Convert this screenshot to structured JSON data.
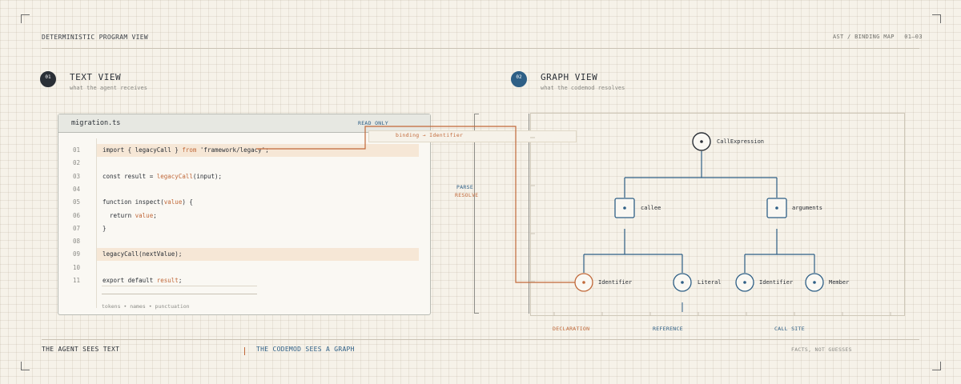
{
  "header": {
    "left_title": "DETERMINISTIC PROGRAM VIEW",
    "right_meta": "AST / BINDING MAP",
    "right_range": "01—03"
  },
  "text_section": {
    "badge": "01",
    "title": "TEXT VIEW",
    "subtitle": "what the agent receives"
  },
  "graph_section": {
    "badge": "02",
    "title": "GRAPH VIEW",
    "subtitle": "what the codemod resolves"
  },
  "editor": {
    "filename": "migration.ts",
    "mode": "READ ONLY",
    "footer": "tokens • names • punctuation",
    "lines": [
      {
        "n": "01",
        "parts": [
          [
            "import { ",
            "n"
          ],
          [
            "legacyCall",
            "n"
          ],
          [
            " } ",
            "n"
          ],
          [
            "from",
            "o"
          ],
          [
            " 'framework/legacy';",
            "n"
          ]
        ],
        "highlight": true
      },
      {
        "n": "02",
        "parts": [],
        "highlight": false
      },
      {
        "n": "03",
        "parts": [
          [
            "const result = ",
            "n"
          ],
          [
            "legacyCall",
            "o"
          ],
          [
            "(input);",
            "n"
          ]
        ],
        "highlight": false
      },
      {
        "n": "04",
        "parts": [],
        "highlight": false
      },
      {
        "n": "05",
        "parts": [
          [
            "function inspect(",
            "n"
          ],
          [
            "value",
            "o"
          ],
          [
            ") {",
            "n"
          ]
        ],
        "highlight": false
      },
      {
        "n": "06",
        "parts": [
          [
            "  return ",
            "n"
          ],
          [
            "value",
            "o"
          ],
          [
            ";",
            "n"
          ]
        ],
        "highlight": false
      },
      {
        "n": "07",
        "parts": [
          [
            "}",
            "n"
          ]
        ],
        "highlight": false
      },
      {
        "n": "08",
        "parts": [],
        "highlight": false
      },
      {
        "n": "09",
        "parts": [
          [
            "legacyCall(nextValue);",
            "n"
          ]
        ],
        "highlight": true
      },
      {
        "n": "10",
        "parts": [],
        "highlight": false
      },
      {
        "n": "11",
        "parts": [
          [
            "export default ",
            "n"
          ],
          [
            "result",
            "o"
          ],
          [
            ";",
            "n"
          ]
        ],
        "highlight": false
      }
    ]
  },
  "connector": {
    "binding_label": "binding → Identifier",
    "parse_label": "PARSE",
    "resolve_label": "RESOLVE"
  },
  "graph": {
    "root": "CallExpression",
    "mid": [
      "callee",
      "arguments"
    ],
    "leaves": [
      "Identifier",
      "Literal",
      "Identifier",
      "Member"
    ],
    "axis_labels": [
      "DECLARATION",
      "REFERENCE",
      "CALL SITE"
    ]
  },
  "footer": {
    "left": "THE AGENT SEES TEXT",
    "middle": "THE CODEMOD SEES A GRAPH",
    "right": "FACTS, NOT GUESSES"
  },
  "colors": {
    "ink": "#2a2f36",
    "blue": "#2e5f86",
    "orange": "#c1693a",
    "highlight": "#f6e7d6"
  }
}
